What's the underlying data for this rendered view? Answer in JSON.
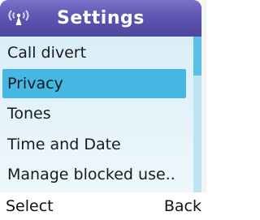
{
  "header": {
    "title": "Settings",
    "signal_icon": "signal-antenna-icon"
  },
  "menu": {
    "items": [
      {
        "label": "Call divert",
        "selected": false
      },
      {
        "label": "Privacy",
        "selected": true
      },
      {
        "label": "Tones",
        "selected": false
      },
      {
        "label": "Time and Date",
        "selected": false
      },
      {
        "label": "Manage blocked use..",
        "selected": false
      }
    ],
    "scroll_position": 0
  },
  "softkeys": {
    "left": "Select",
    "right": "Back"
  },
  "colors": {
    "title_bar": "#5f55b3",
    "list_background": "#e0f1f9",
    "selection": "#44b7e3",
    "scroll_thumb": "#5bbfe6"
  }
}
